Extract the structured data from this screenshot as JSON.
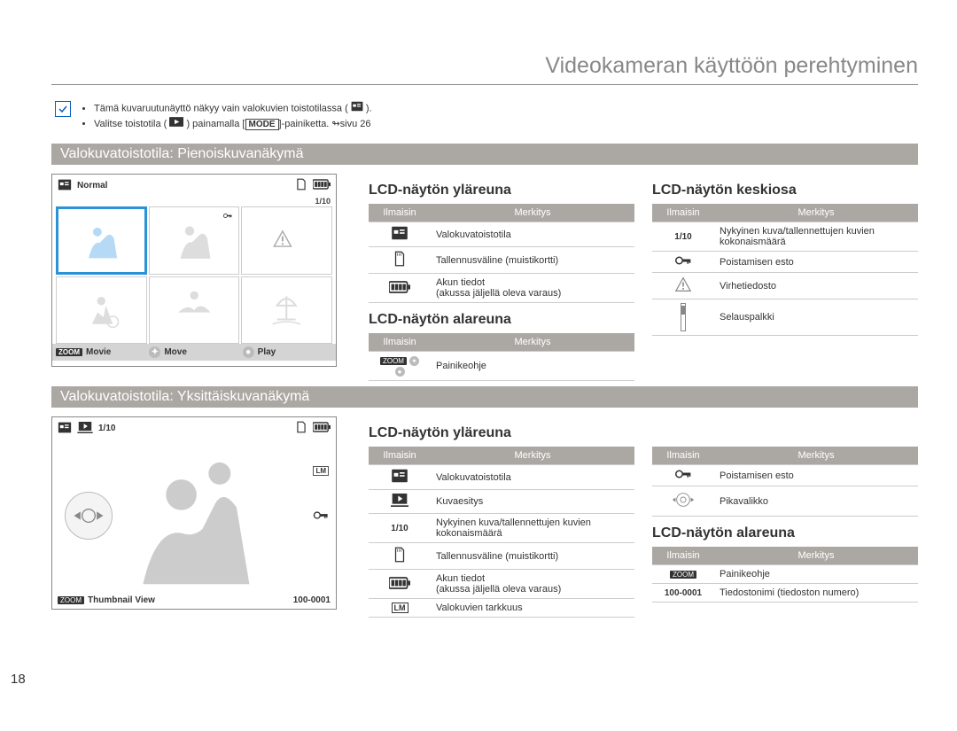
{
  "page_number": "18",
  "heading": "Videokameran käyttöön perehtyminen",
  "info": {
    "line1_pre": "Tämä kuvaruutunäyttö näkyy vain valokuvien toistotilassa (",
    "line1_post": ").",
    "line2_pre": "Valitse toistotila (",
    "line2_mid": ") painamalla [",
    "mode_label": "MODE",
    "line2_mid2": "]-painiketta.",
    "line2_ref": "sivu 26"
  },
  "section1_title": "Valokuvatoistotila: Pienoiskuvanäkymä",
  "lcd1": {
    "normal": "Normal",
    "count": "1/10",
    "bottom": {
      "zoom": "ZOOM",
      "movie": "Movie",
      "move": "Move",
      "play": "Play"
    }
  },
  "headers": {
    "ind": "Ilmaisin",
    "mean": "Merkitys"
  },
  "top1_title": "LCD-näytön yläreuna",
  "top1_rows": [
    "Valokuvatoistotila",
    "Tallennusväline (muistikortti)",
    "Akun tiedot\n(akussa jäljellä oleva varaus)"
  ],
  "bot1_title": "LCD-näytön alareuna",
  "bot1_rows": [
    "Painikeohje"
  ],
  "mid_title": "LCD-näytön keskiosa",
  "mid_rows": [
    {
      "ind": "1/10",
      "mean": "Nykyinen kuva/tallennettujen kuvien kokonaismäärä"
    },
    {
      "ind": "key",
      "mean": "Poistamisen esto"
    },
    {
      "ind": "warn",
      "mean": "Virhetiedosto"
    },
    {
      "ind": "scroll",
      "mean": "Selauspalkki"
    }
  ],
  "section2_title": "Valokuvatoistotila: Yksittäiskuvanäkymä",
  "lcd2": {
    "count": "1/10",
    "bottom_zoom": "ZOOM",
    "bottom_label": "Thumbnail View",
    "file": "100-0001"
  },
  "top2_title": "LCD-näytön yläreuna",
  "top2_rows": [
    {
      "mean": "Valokuvatoistotila"
    },
    {
      "mean": "Kuvaesitys"
    },
    {
      "ind": "1/10",
      "mean": "Nykyinen kuva/tallennettujen kuvien kokonaismäärä"
    },
    {
      "mean": "Tallennusväline (muistikortti)"
    },
    {
      "mean": "Akun tiedot\n(akussa jäljellä oleva varaus)"
    },
    {
      "mean": "Valokuvien tarkkuus"
    }
  ],
  "right2a_rows": [
    {
      "mean": "Poistamisen esto"
    },
    {
      "mean": "Pikavalikko"
    }
  ],
  "bot2_title": "LCD-näytön alareuna",
  "bot2_rows": [
    {
      "ind": "ZOOM",
      "mean": "Painikeohje"
    },
    {
      "ind": "100-0001",
      "mean": "Tiedostonimi (tiedoston numero)"
    }
  ]
}
